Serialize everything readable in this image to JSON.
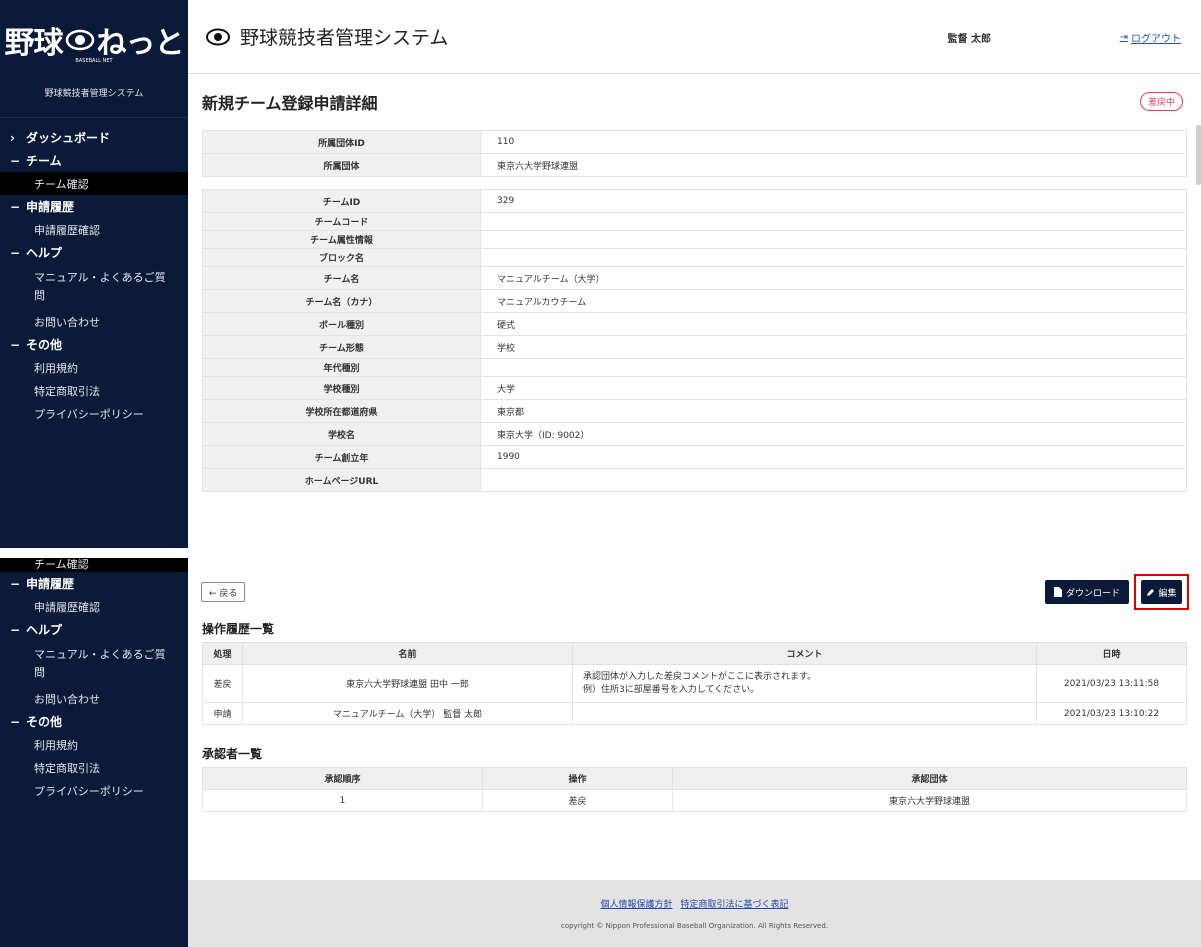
{
  "sidebar": {
    "logo_text_left": "野球",
    "logo_text_right": "ねっと",
    "logo_small": "BASEBALL NET",
    "system_name": "野球競技者管理システム",
    "items": [
      {
        "label": "ダッシュボード",
        "mark": "›"
      },
      {
        "label": "チーム",
        "mark": "−"
      },
      {
        "label": "チーム確認"
      },
      {
        "label": "申請履歴",
        "mark": "−"
      },
      {
        "label": "申請履歴確認"
      },
      {
        "label": "ヘルプ",
        "mark": "−"
      },
      {
        "label": "マニュアル・よくあるご質問"
      },
      {
        "label": "お問い合わせ"
      },
      {
        "label": "その他",
        "mark": "−"
      },
      {
        "label": "利用規約"
      },
      {
        "label": "特定商取引法"
      },
      {
        "label": "プライバシーポリシー"
      }
    ]
  },
  "header": {
    "app_title": "野球競技者管理システム",
    "user": "監督 太郎",
    "logout": "ログアウト"
  },
  "page": {
    "title": "新規チーム登録申請詳細",
    "status": "差戻中"
  },
  "org_info": [
    {
      "key": "所属団体ID",
      "value": "110"
    },
    {
      "key": "所属団体",
      "value": "東京六大学野球連盟"
    }
  ],
  "team_info": [
    {
      "key": "チームID",
      "value": "329"
    },
    {
      "key": "チームコード",
      "value": ""
    },
    {
      "key": "チーム属性情報",
      "value": ""
    },
    {
      "key": "ブロック名",
      "value": ""
    },
    {
      "key": "チーム名",
      "value": "マニュアルチーム（大学）"
    },
    {
      "key": "チーム名（カナ）",
      "value": "マニュアルカウチーム"
    },
    {
      "key": "ボール種別",
      "value": "硬式"
    },
    {
      "key": "チーム形態",
      "value": "学校"
    },
    {
      "key": "年代種別",
      "value": ""
    },
    {
      "key": "学校種別",
      "value": "大学"
    },
    {
      "key": "学校所在都道府県",
      "value": "東京都"
    },
    {
      "key": "学校名",
      "value": "東京大学（ID: 9002）"
    },
    {
      "key": "チーム創立年",
      "value": "1990"
    },
    {
      "key": "ホームページURL",
      "value": ""
    }
  ],
  "buttons": {
    "back": "← 戻る",
    "download": "ダウンロード",
    "edit": "編集"
  },
  "history": {
    "title": "操作履歴一覧",
    "headers": [
      "処理",
      "名前",
      "コメント",
      "日時"
    ],
    "rows": [
      {
        "action": "差戻",
        "name": "東京六大学野球連盟 田中 一郎",
        "comment1": "承認団体が入力した差戻コメントがここに表示されます。",
        "comment2": "例）住所3に部屋番号を入力してください。",
        "date": "2021/03/23 13:11:58"
      },
      {
        "action": "申請",
        "name": "マニュアルチーム（大学） 監督 太郎",
        "comment1": "",
        "comment2": "",
        "date": "2021/03/23 13:10:22"
      }
    ]
  },
  "approvers": {
    "title": "承認者一覧",
    "headers": [
      "承認順序",
      "操作",
      "承認団体"
    ],
    "rows": [
      {
        "order": "1",
        "op": "差戻",
        "org": "東京六大学野球連盟"
      }
    ]
  },
  "footer": {
    "link1": "個人情報保護方針",
    "link2": "特定商取引法に基づく表記",
    "copyright": "copyright © Nippon Professional Baseball Organization. All Rights Reserved."
  }
}
